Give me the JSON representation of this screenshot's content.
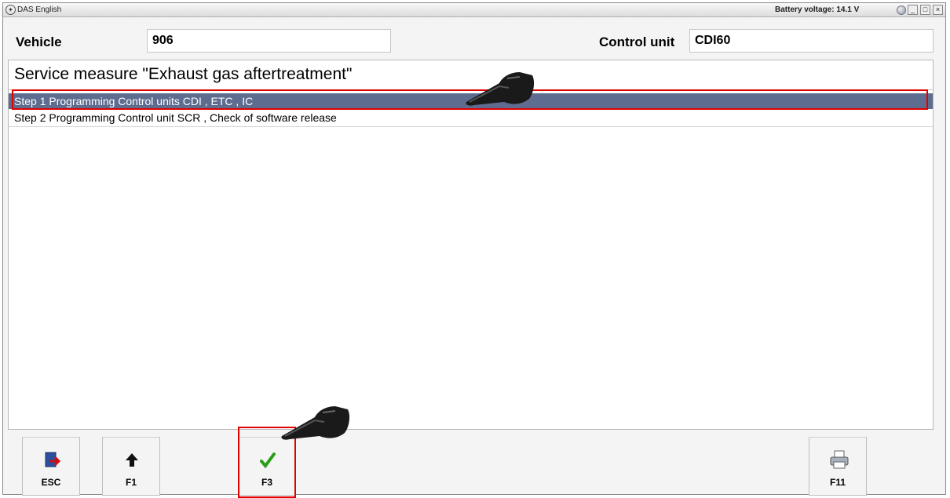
{
  "titlebar": {
    "app_title": "DAS English",
    "battery": "Battery voltage: 14.1 V",
    "minimize": "_",
    "maximize": "□",
    "close": "×"
  },
  "header": {
    "vehicle_label": "Vehicle",
    "vehicle_value": "906",
    "control_unit_label": "Control unit",
    "control_unit_value": "CDI60"
  },
  "main": {
    "title": "Service measure \"Exhaust gas aftertreatment\"",
    "items": [
      {
        "label": "Step 1 Programming Control units CDI , ETC , IC"
      },
      {
        "label": "Step 2 Programming Control unit SCR , Check of software release"
      }
    ]
  },
  "footer": {
    "buttons": [
      {
        "label": "ESC",
        "icon": "exit-door-icon"
      },
      {
        "label": "F1",
        "icon": "arrow-up-icon"
      },
      {
        "label": "F3",
        "icon": "checkmark-icon"
      },
      {
        "label": "F11",
        "icon": "printer-icon"
      }
    ]
  },
  "colors": {
    "selection": "#5e6d8f",
    "highlight": "#e00000",
    "check": "#2a9d1a"
  }
}
